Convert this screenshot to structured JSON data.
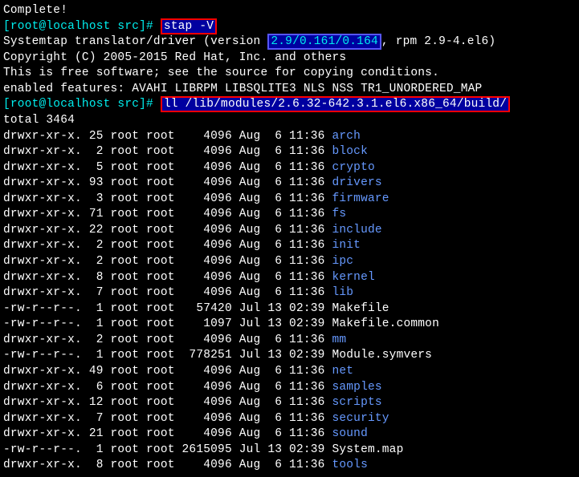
{
  "complete": "Complete!",
  "prompt_open": "[root@localhost src]#",
  "cmd1": "stap -V",
  "stap_version_prefix": "Systemtap translator/driver (version",
  "stap_version_boxed": "2.9/0.161/0.164",
  "stap_version_suffix": ", rpm 2.9-4.el6)",
  "copyright": "Copyright (C) 2005-2015 Red Hat, Inc. and others",
  "free1": "This is free software; see the source for copying conditions.",
  "features": "enabled features: AVAHI LIBRPM LIBSQLITE3 NLS NSS TR1_UNORDERED_MAP",
  "cmd2": "ll /lib/modules/2.6.32-642.3.1.el6.x86_64/build/",
  "total": "total 3464",
  "rows": [
    {
      "perm": "drwxr-xr-x.",
      "links": "25",
      "owner": "root",
      "group": "root",
      "size": "4096",
      "month": "Aug",
      "day": "6",
      "time": "11:36",
      "name": "arch",
      "blue": true
    },
    {
      "perm": "drwxr-xr-x.",
      "links": "2",
      "owner": "root",
      "group": "root",
      "size": "4096",
      "month": "Aug",
      "day": "6",
      "time": "11:36",
      "name": "block",
      "blue": true
    },
    {
      "perm": "drwxr-xr-x.",
      "links": "5",
      "owner": "root",
      "group": "root",
      "size": "4096",
      "month": "Aug",
      "day": "6",
      "time": "11:36",
      "name": "crypto",
      "blue": true
    },
    {
      "perm": "drwxr-xr-x.",
      "links": "93",
      "owner": "root",
      "group": "root",
      "size": "4096",
      "month": "Aug",
      "day": "6",
      "time": "11:36",
      "name": "drivers",
      "blue": true
    },
    {
      "perm": "drwxr-xr-x.",
      "links": "3",
      "owner": "root",
      "group": "root",
      "size": "4096",
      "month": "Aug",
      "day": "6",
      "time": "11:36",
      "name": "firmware",
      "blue": true
    },
    {
      "perm": "drwxr-xr-x.",
      "links": "71",
      "owner": "root",
      "group": "root",
      "size": "4096",
      "month": "Aug",
      "day": "6",
      "time": "11:36",
      "name": "fs",
      "blue": true
    },
    {
      "perm": "drwxr-xr-x.",
      "links": "22",
      "owner": "root",
      "group": "root",
      "size": "4096",
      "month": "Aug",
      "day": "6",
      "time": "11:36",
      "name": "include",
      "blue": true
    },
    {
      "perm": "drwxr-xr-x.",
      "links": "2",
      "owner": "root",
      "group": "root",
      "size": "4096",
      "month": "Aug",
      "day": "6",
      "time": "11:36",
      "name": "init",
      "blue": true
    },
    {
      "perm": "drwxr-xr-x.",
      "links": "2",
      "owner": "root",
      "group": "root",
      "size": "4096",
      "month": "Aug",
      "day": "6",
      "time": "11:36",
      "name": "ipc",
      "blue": true
    },
    {
      "perm": "drwxr-xr-x.",
      "links": "8",
      "owner": "root",
      "group": "root",
      "size": "4096",
      "month": "Aug",
      "day": "6",
      "time": "11:36",
      "name": "kernel",
      "blue": true
    },
    {
      "perm": "drwxr-xr-x.",
      "links": "7",
      "owner": "root",
      "group": "root",
      "size": "4096",
      "month": "Aug",
      "day": "6",
      "time": "11:36",
      "name": "lib",
      "blue": true
    },
    {
      "perm": "-rw-r--r--.",
      "links": "1",
      "owner": "root",
      "group": "root",
      "size": "57420",
      "month": "Jul",
      "day": "13",
      "time": "02:39",
      "name": "Makefile",
      "blue": false
    },
    {
      "perm": "-rw-r--r--.",
      "links": "1",
      "owner": "root",
      "group": "root",
      "size": "1097",
      "month": "Jul",
      "day": "13",
      "time": "02:39",
      "name": "Makefile.common",
      "blue": false
    },
    {
      "perm": "drwxr-xr-x.",
      "links": "2",
      "owner": "root",
      "group": "root",
      "size": "4096",
      "month": "Aug",
      "day": "6",
      "time": "11:36",
      "name": "mm",
      "blue": true
    },
    {
      "perm": "-rw-r--r--.",
      "links": "1",
      "owner": "root",
      "group": "root",
      "size": "778251",
      "month": "Jul",
      "day": "13",
      "time": "02:39",
      "name": "Module.symvers",
      "blue": false
    },
    {
      "perm": "drwxr-xr-x.",
      "links": "49",
      "owner": "root",
      "group": "root",
      "size": "4096",
      "month": "Aug",
      "day": "6",
      "time": "11:36",
      "name": "net",
      "blue": true
    },
    {
      "perm": "drwxr-xr-x.",
      "links": "6",
      "owner": "root",
      "group": "root",
      "size": "4096",
      "month": "Aug",
      "day": "6",
      "time": "11:36",
      "name": "samples",
      "blue": true
    },
    {
      "perm": "drwxr-xr-x.",
      "links": "12",
      "owner": "root",
      "group": "root",
      "size": "4096",
      "month": "Aug",
      "day": "6",
      "time": "11:36",
      "name": "scripts",
      "blue": true
    },
    {
      "perm": "drwxr-xr-x.",
      "links": "7",
      "owner": "root",
      "group": "root",
      "size": "4096",
      "month": "Aug",
      "day": "6",
      "time": "11:36",
      "name": "security",
      "blue": true
    },
    {
      "perm": "drwxr-xr-x.",
      "links": "21",
      "owner": "root",
      "group": "root",
      "size": "4096",
      "month": "Aug",
      "day": "6",
      "time": "11:36",
      "name": "sound",
      "blue": true
    },
    {
      "perm": "-rw-r--r--.",
      "links": "1",
      "owner": "root",
      "group": "root",
      "size": "2615095",
      "month": "Jul",
      "day": "13",
      "time": "02:39",
      "name": "System.map",
      "blue": false
    },
    {
      "perm": "drwxr-xr-x.",
      "links": "8",
      "owner": "root",
      "group": "root",
      "size": "4096",
      "month": "Aug",
      "day": "6",
      "time": "11:36",
      "name": "tools",
      "blue": true
    }
  ]
}
